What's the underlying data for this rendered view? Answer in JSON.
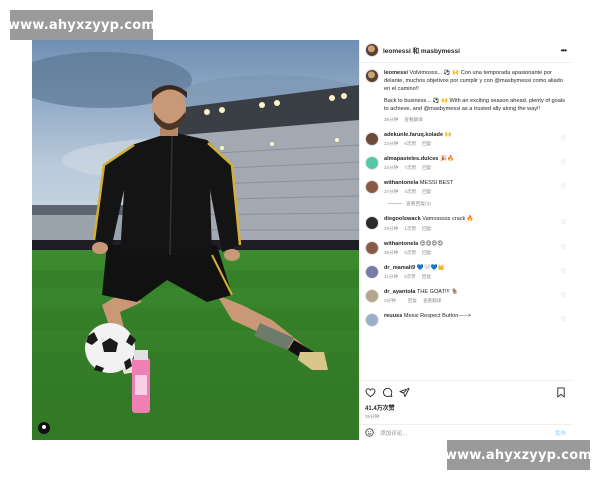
{
  "watermarks": {
    "top": "www.ahyxzyyp.com",
    "bottom": "www.ahyxzyyp.com"
  },
  "post": {
    "header": {
      "title": "leomessi 和 masbymessi",
      "more_label": "•••"
    },
    "caption": {
      "username": "leomessi",
      "text_es": "Volvimosss... ⚽ 🙌 Con una temporada apasionante por delante, muchos objetivos por cumplir y con @masbymessi como aliado en el camino!!",
      "text_en": "Back to business... ⚽ 🙌 With an exciting season ahead, plenty of goals to achieve, and @masbymessi as a trusted ally along the way!!",
      "time": "39分钟",
      "translate": "查看翻译"
    },
    "comments": [
      {
        "username": "adekunle.faruq.kolade",
        "text": "🙌",
        "time": "32分钟",
        "likes": "6次赞",
        "reply": "回复",
        "translate": "",
        "avatar_color": "#6d4b3a",
        "view_replies": ""
      },
      {
        "username": "almapasteles.dulces",
        "text": "🎉🔥",
        "time": "34分钟",
        "likes": "7次赞",
        "reply": "回复",
        "translate": "",
        "avatar_color": "#55c6a8",
        "view_replies": ""
      },
      {
        "username": "withantonela",
        "text": "MESSI BEST",
        "time": "37分钟",
        "likes": "4次赞",
        "reply": "回复",
        "translate": "",
        "avatar_color": "#8a5a44",
        "view_replies": "查看回复(3)"
      },
      {
        "username": "diegoolswack",
        "text": "Vamosssss crack 🔥",
        "time": "29分钟",
        "likes": "1次赞",
        "reply": "回复",
        "translate": "",
        "avatar_color": "#2b2b2b",
        "view_replies": ""
      },
      {
        "username": "withantonela",
        "text": "😍😍😍😍",
        "time": "38分钟",
        "likes": "5次赞",
        "reply": "回复",
        "translate": "",
        "avatar_color": "#8a5a44",
        "view_replies": ""
      },
      {
        "username": "dr_mamali9",
        "text": "💙🤍💙👑",
        "time": "11分钟",
        "likes": "3次赞",
        "reply": "回复",
        "translate": "",
        "avatar_color": "#7a7aa8",
        "view_replies": ""
      },
      {
        "username": "dr_ayantola",
        "text": "THE GOAT!!! 🐐",
        "time": "3分钟",
        "likes": "",
        "reply": "回复",
        "translate": "查看翻译",
        "avatar_color": "#b5a58a",
        "view_replies": ""
      },
      {
        "username": "reuuss",
        "text": "Messi Respect Button----->",
        "time": "",
        "likes": "",
        "reply": "",
        "translate": "",
        "avatar_color": "#9bb0c8",
        "view_replies": ""
      }
    ],
    "stats": {
      "likes": "41.4万次赞",
      "ago": "39分钟"
    },
    "add_comment": {
      "placeholder": "添加评论...",
      "post_label": "发布"
    }
  },
  "colors": {
    "link": "#00376b",
    "muted": "#8e8e8e",
    "post_button": "#b2dffc",
    "pitch": "#3f8a2f",
    "sky": "#8fb0cc"
  },
  "icons": [
    "heart-icon",
    "comment-icon",
    "share-icon",
    "bookmark-icon",
    "emoji-icon",
    "more-icon",
    "user-tag-icon"
  ]
}
